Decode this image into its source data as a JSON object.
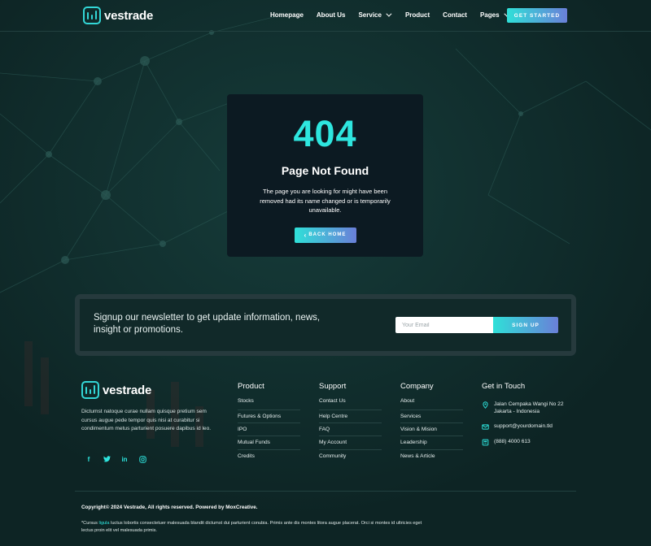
{
  "brand": {
    "name": "vestrade",
    "accent": "#2ee6df",
    "accent_end": "#6a7fd8",
    "background": "#0f2a2a"
  },
  "nav": {
    "items": [
      {
        "label": "Homepage",
        "has_dropdown": false
      },
      {
        "label": "About Us",
        "has_dropdown": false
      },
      {
        "label": "Service",
        "has_dropdown": true
      },
      {
        "label": "Product",
        "has_dropdown": false
      },
      {
        "label": "Contact",
        "has_dropdown": false
      },
      {
        "label": "Pages",
        "has_dropdown": true
      }
    ],
    "cta": "GET STARTED"
  },
  "error": {
    "code": "404",
    "title": "Page Not Found",
    "message": "The page you are looking for might have been removed had its name changed or is temporarily unavailable.",
    "back_icon": "‹",
    "back_label": "BACK HOME"
  },
  "newsletter": {
    "text": "Signup our newsletter to get update information, news, insight or promotions.",
    "email_placeholder": "Your Email",
    "button": "SIGN UP"
  },
  "footer": {
    "description": "Dictumst natoque curae nullam quisque pretium sem cursus augue pede tempor quis nisi at curabitur si condimentum metus parturient posuere dapibus id leo.",
    "social_icons": [
      "facebook-icon",
      "twitter-icon",
      "linkedin-icon",
      "instagram-icon"
    ],
    "product": {
      "title": "Product",
      "links": [
        "Stocks",
        "Futures & Options",
        "IPO",
        "Mutual Funds",
        "Credits"
      ]
    },
    "support": {
      "title": "Support",
      "links": [
        "Contact Us",
        "Help Centre",
        "FAQ",
        "My Account",
        "Community"
      ]
    },
    "company": {
      "title": "Company",
      "links": [
        "About",
        "Services",
        "Vision & Mision",
        "Leadership",
        "News & Article"
      ]
    },
    "touch": {
      "title": "Get in Touch",
      "address_line1": "Jalan Cempaka Wangi No 22",
      "address_line2": "Jakarta - Indonesia",
      "email": "support@yourdomain.tld",
      "phone": "(888) 4000 613"
    },
    "copyright": "Copyright© 2024 Vestrade, All rights reserved. Powered by MoxCreative.",
    "small_prefix": "*Cursus ",
    "small_link": "ligula",
    "small_rest": " luctus lobortis consectetuer malesuada blandit dictumst dui parturient conubia. Primis ante dis montes litora augue placerat. Orci si montes id ultricies eget lectus proin elit vel malesuada primis."
  }
}
